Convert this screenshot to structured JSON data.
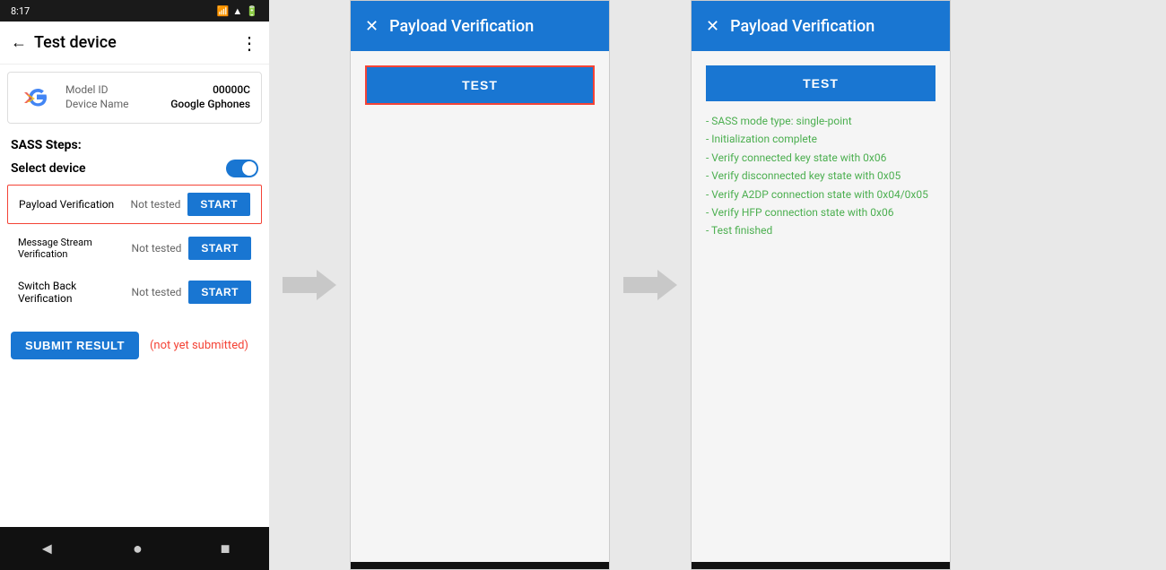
{
  "phone": {
    "status_bar": {
      "time": "8:17",
      "icons": [
        "sim",
        "wifi",
        "battery"
      ]
    },
    "app_bar": {
      "back_label": "←",
      "title": "Test device",
      "menu_icon": "⋮"
    },
    "device_info": {
      "model_label": "Model ID",
      "model_value": "00000C",
      "device_label": "Device Name",
      "device_value": "Google Gphones"
    },
    "sass_steps_label": "SASS Steps:",
    "select_device_label": "Select device",
    "tests": [
      {
        "name": "Payload Verification",
        "status": "Not tested",
        "button": "START",
        "highlighted": true
      },
      {
        "name": "Message Stream Verification",
        "status": "Not tested",
        "button": "START",
        "highlighted": false
      },
      {
        "name": "Switch Back Verification",
        "status": "Not tested",
        "button": "START",
        "highlighted": false
      }
    ],
    "submit_button": "SUBMIT RESULT",
    "submit_status": "(not yet submitted)",
    "nav": {
      "back": "◄",
      "home": "●",
      "recent": "■"
    }
  },
  "dialog1": {
    "close_icon": "✕",
    "title": "Payload Verification",
    "test_button": "TEST"
  },
  "dialog2": {
    "close_icon": "✕",
    "title": "Payload Verification",
    "test_button": "TEST",
    "results": [
      "- SASS mode type: single-point",
      "- Initialization complete",
      "- Verify connected key state with 0x06",
      "- Verify disconnected key state with 0x05",
      "- Verify A2DP connection state with 0x04/0x05",
      "- Verify HFP connection state with 0x06",
      "- Test finished"
    ]
  },
  "colors": {
    "primary": "#1976d2",
    "danger": "#f44336",
    "success": "#4caf50",
    "not_submitted": "#f44336"
  }
}
